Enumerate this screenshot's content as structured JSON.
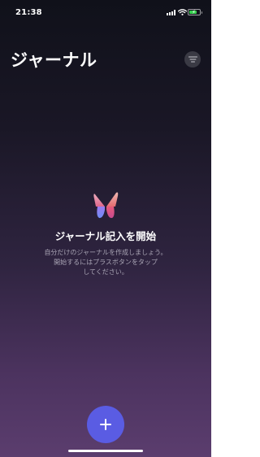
{
  "status_bar": {
    "time": "21:38",
    "battery_color": "#35d14e"
  },
  "header": {
    "title": "ジャーナル",
    "filter_icon": "filter-lines-icon"
  },
  "empty_state": {
    "icon": "journal-butterfly-icon",
    "title": "ジャーナル記入を開始",
    "description": "自分だけのジャーナルを作成しましょう。\n開始するにはプラスボタンをタップ\nしてください。"
  },
  "add_button": {
    "icon": "plus-icon",
    "color": "#5a5ce3"
  }
}
